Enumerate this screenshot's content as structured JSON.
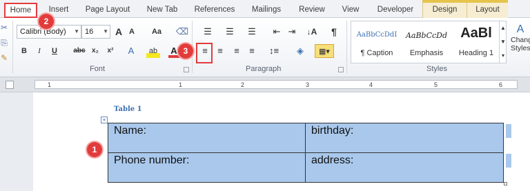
{
  "ribbon_tabs": [
    "Home",
    "Insert",
    "Page Layout",
    "New Tab",
    "References",
    "Mailings",
    "Review",
    "View",
    "Developer",
    "Design",
    "Layout"
  ],
  "font": {
    "family": "Calibri (Body)",
    "size": "16",
    "group_label": "Font",
    "grow": "A",
    "shrink": "A",
    "change_case": "Aa",
    "bold": "B",
    "italic": "I",
    "underline": "U",
    "strike": "abc",
    "subscript": "x₂",
    "superscript": "x²"
  },
  "paragraph": {
    "group_label": "Paragraph",
    "show_marks": "¶"
  },
  "styles": {
    "group_label": "Styles",
    "items": [
      {
        "sample": "AaBbCcDdI",
        "name": "¶ Caption"
      },
      {
        "sample": "AaBbCcDd",
        "name": "Emphasis"
      },
      {
        "sample": "AaBl",
        "name": "Heading 1"
      }
    ],
    "change_label": "Change Styles"
  },
  "ruler_numbers": [
    "1",
    "1",
    "2",
    "3",
    "4",
    "5",
    "6"
  ],
  "document": {
    "caption": "Table 1",
    "table": [
      [
        "Name:",
        "birthday:"
      ],
      [
        "Phone number:",
        "address:"
      ]
    ]
  },
  "callouts": [
    "1",
    "2",
    "3"
  ],
  "colors": {
    "accent_red": "#e23b3b",
    "table_fill": "#a9c8ec"
  }
}
